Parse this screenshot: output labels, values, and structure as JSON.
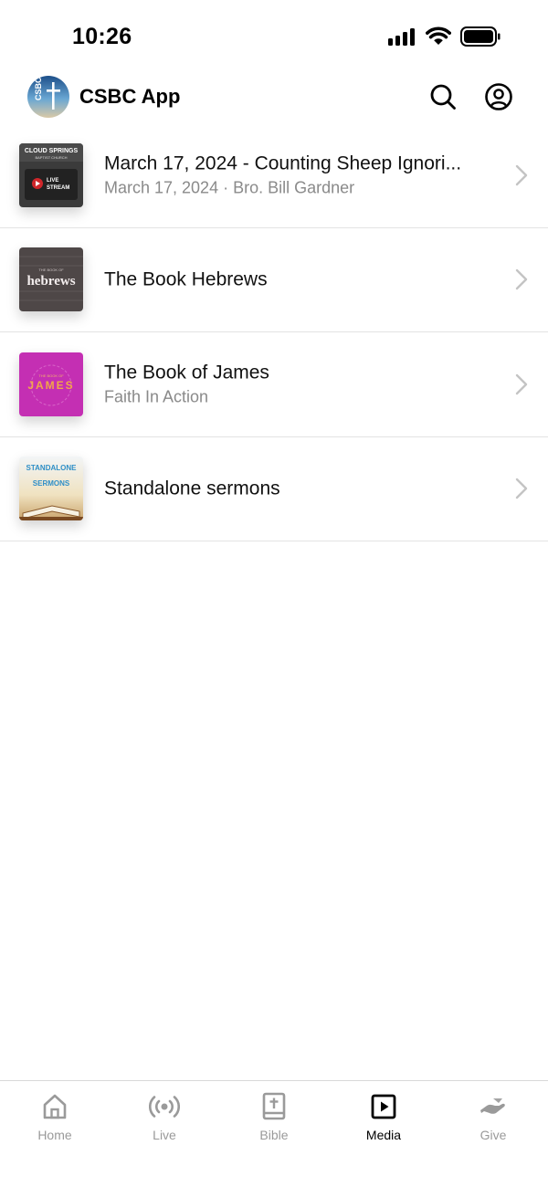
{
  "status_bar": {
    "time": "10:26"
  },
  "header": {
    "title": "CSBC App",
    "logo_text": "CSBC"
  },
  "media_items": [
    {
      "title": "March 17, 2024 - Counting Sheep Ignori...",
      "subtitle": "March 17, 2024 · Bro. Bill Gardner",
      "thumb_text": [
        "CLOUD SPRINGS",
        "BAPTIST CHURCH",
        "LIVE",
        "STREAM"
      ]
    },
    {
      "title": "The Book Hebrews",
      "subtitle": "",
      "thumb_text": [
        "THE BOOK OF",
        "hebrews"
      ]
    },
    {
      "title": "The Book of James",
      "subtitle": "Faith In Action",
      "thumb_text": [
        "THE BOOK OF",
        "JAMES"
      ]
    },
    {
      "title": "Standalone sermons",
      "subtitle": "",
      "thumb_text": [
        "STANDALONE",
        "SERMONS"
      ]
    }
  ],
  "tabs": [
    {
      "label": "Home",
      "icon": "home-icon",
      "active": false
    },
    {
      "label": "Live",
      "icon": "broadcast-icon",
      "active": false
    },
    {
      "label": "Bible",
      "icon": "bible-icon",
      "active": false
    },
    {
      "label": "Media",
      "icon": "play-square-icon",
      "active": true
    },
    {
      "label": "Give",
      "icon": "give-hand-icon",
      "active": false
    }
  ],
  "colors": {
    "accent": "#000000",
    "inactive_tab": "#9a9a9a",
    "subtitle": "#8a8a8a",
    "divider": "#e3e3e3",
    "james_thumb": "#c42fb3",
    "hebrews_thumb": "#4e4747"
  }
}
